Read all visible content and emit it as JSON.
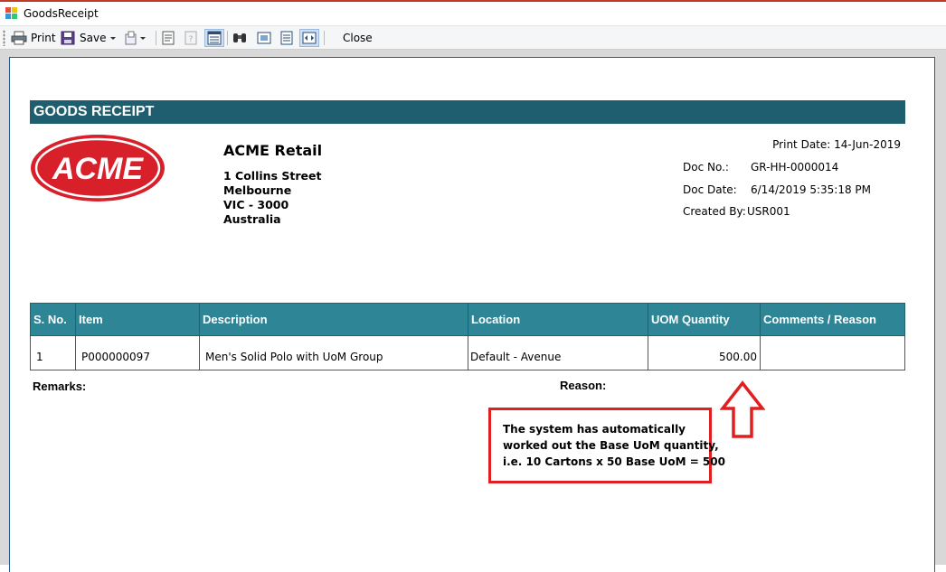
{
  "window": {
    "title": "GoodsReceipt"
  },
  "toolbar": {
    "print_label": "Print",
    "save_label": "Save",
    "close_label": "Close"
  },
  "report": {
    "banner": "GOODS RECEIPT",
    "logo_text": "ACME",
    "company": {
      "name": "ACME Retail",
      "address": [
        "1 Collins Street",
        "Melbourne",
        "VIC - 3000",
        "Australia"
      ]
    },
    "print_date": "Print Date: 14-Jun-2019",
    "doc_no_label": "Doc No.:",
    "doc_no": "GR-HH-0000014",
    "doc_date_label": "Doc Date:",
    "doc_date": "6/14/2019 5:35:18 PM",
    "created_by_label": "Created By:",
    "created_by": "USR001",
    "columns": [
      "S. No.",
      "Item",
      "Description",
      "Location",
      "UOM Quantity",
      "Comments / Reason"
    ],
    "rows": [
      {
        "sno": "1",
        "item": "P000000097",
        "description": "Men's Solid Polo with UoM Group",
        "location": "Default - Avenue",
        "uom_qty": "500.00",
        "comments": ""
      }
    ],
    "remarks_label": "Remarks:",
    "reason_label": "Reason:"
  },
  "annotation": {
    "lines": [
      "The system has automatically",
      "worked out the Base UoM quantity,",
      "i.e. 10 Cartons x 50 Base UoM = 500"
    ],
    "color": "#e02020"
  }
}
